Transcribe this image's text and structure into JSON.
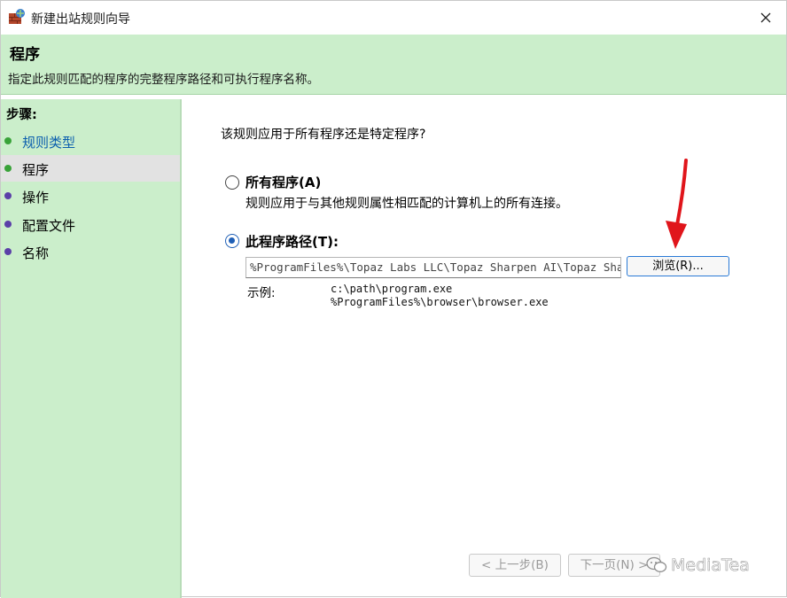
{
  "window": {
    "title": "新建出站规则向导",
    "icon": "firewall-app-icon"
  },
  "header": {
    "title": "程序",
    "subtitle": "指定此规则匹配的程序的完整程序路径和可执行程序名称。"
  },
  "steps": {
    "title": "步骤:",
    "items": [
      {
        "label": "规则类型",
        "state": "link",
        "dot": "green"
      },
      {
        "label": "程序",
        "state": "active",
        "dot": "green"
      },
      {
        "label": "操作",
        "state": "normal",
        "dot": "purple"
      },
      {
        "label": "配置文件",
        "state": "normal",
        "dot": "purple"
      },
      {
        "label": "名称",
        "state": "normal",
        "dot": "purple"
      }
    ]
  },
  "content": {
    "question": "该规则应用于所有程序还是特定程序?",
    "option_all": {
      "label": "所有程序(A)",
      "description": "规则应用于与其他规则属性相匹配的计算机上的所有连接。",
      "checked": false
    },
    "option_path": {
      "label": "此程序路径(T):",
      "checked": true
    },
    "path_value": "%ProgramFiles%\\Topaz Labs LLC\\Topaz Sharpen AI\\Topaz Sharpen AI.exe",
    "browse_label": "浏览(R)...",
    "example_label": "示例:",
    "example_lines": [
      "c:\\path\\program.exe",
      "%ProgramFiles%\\browser\\browser.exe"
    ]
  },
  "footer": {
    "back_label": "< 上一步(B)",
    "next_label": "下一页(N) >"
  },
  "watermark": {
    "text": "MediaTea"
  },
  "colors": {
    "panel_green": "#cbeecb",
    "active_step": "#e2e2e2",
    "link_blue": "#0c5fae",
    "radio_blue": "#1f5fb6",
    "arrow_red": "#e0151b"
  }
}
